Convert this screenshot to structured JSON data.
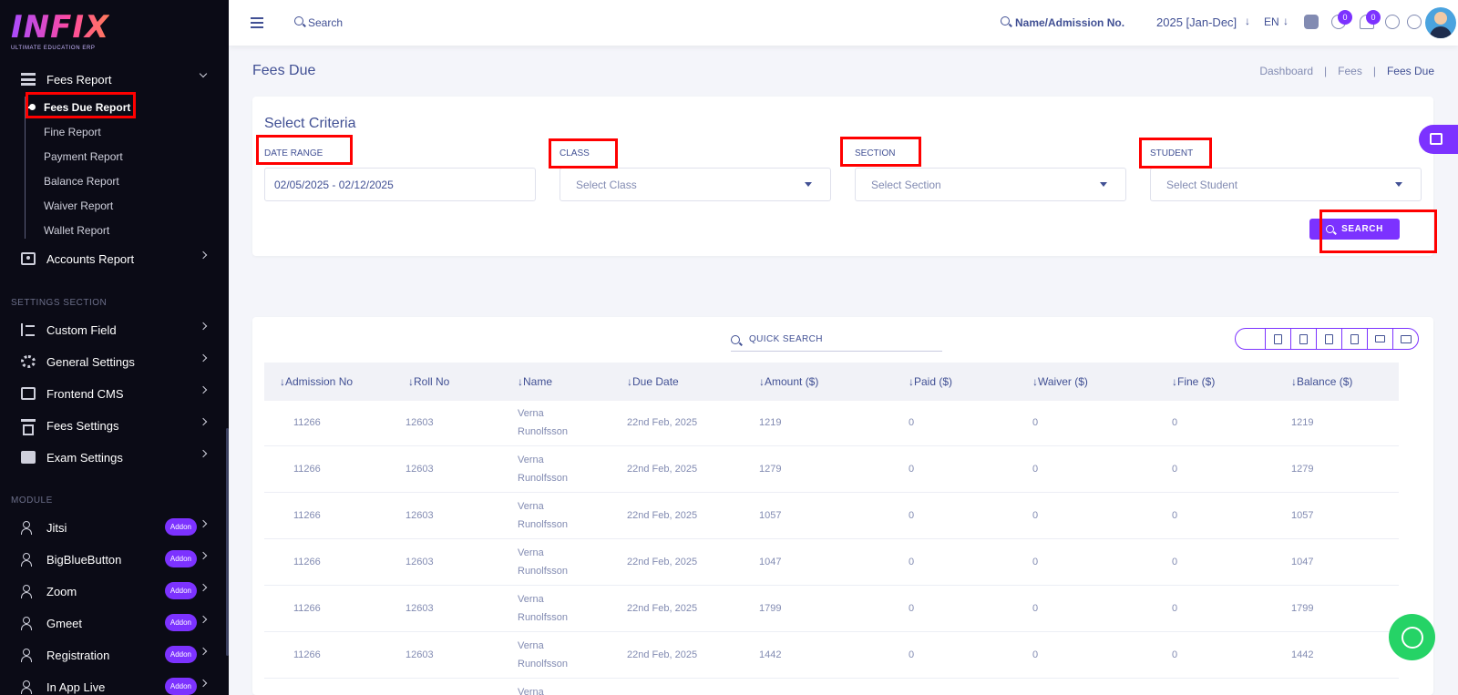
{
  "brand": {
    "name": "INFIX",
    "tagline": "ULTIMATE EDUCATION ERP"
  },
  "sidebar": {
    "fees_report": {
      "label": "Fees Report"
    },
    "fees_sub": [
      "Fees Due Report",
      "Fine Report",
      "Payment Report",
      "Balance Report",
      "Waiver Report",
      "Wallet Report"
    ],
    "accounts_report": "Accounts Report",
    "settings_section_title": "SETTINGS SECTION",
    "settings": [
      "Custom Field",
      "General Settings",
      "Frontend CMS",
      "Fees Settings",
      "Exam Settings"
    ],
    "module_title": "MODULE",
    "modules": [
      "Jitsi",
      "BigBlueButton",
      "Zoom",
      "Gmeet",
      "Registration",
      "In App Live"
    ],
    "addon_label": "Addon"
  },
  "topbar": {
    "search_label": "Search",
    "student_search_label": "Name/Admission No.",
    "session": "2025 [Jan-Dec]",
    "lang": "EN",
    "notification_count": "0",
    "message_count": "0"
  },
  "page": {
    "title": "Fees Due",
    "breadcrumb": [
      "Dashboard",
      "Fees",
      "Fees Due"
    ]
  },
  "criteria": {
    "title": "Select Criteria",
    "date_range_label": "DATE RANGE",
    "date_range_value": "02/05/2025 - 02/12/2025",
    "class_label": "CLASS",
    "class_placeholder": "Select Class",
    "section_label": "SECTION",
    "section_placeholder": "Select Section",
    "student_label": "STUDENT",
    "student_placeholder": "Select Student",
    "search_button": "SEARCH"
  },
  "table": {
    "quick_search": "QUICK SEARCH",
    "export_icons": [
      "copy-icon",
      "excel-icon",
      "csv-icon",
      "pdf-icon",
      "print-icon",
      "column-visibility-icon"
    ],
    "columns": [
      "Admission No",
      "Roll No",
      "Name",
      "Due Date",
      "Amount ($)",
      "Paid ($)",
      "Waiver ($)",
      "Fine ($)",
      "Balance ($)"
    ],
    "rows": [
      {
        "admission": "11266",
        "roll": "12603",
        "name1": "Verna",
        "name2": "Runolfsson",
        "due": "22nd Feb, 2025",
        "amount": "1219",
        "paid": "0",
        "waiver": "0",
        "fine": "0",
        "balance": "1219"
      },
      {
        "admission": "11266",
        "roll": "12603",
        "name1": "Verna",
        "name2": "Runolfsson",
        "due": "22nd Feb, 2025",
        "amount": "1279",
        "paid": "0",
        "waiver": "0",
        "fine": "0",
        "balance": "1279"
      },
      {
        "admission": "11266",
        "roll": "12603",
        "name1": "Verna",
        "name2": "Runolfsson",
        "due": "22nd Feb, 2025",
        "amount": "1057",
        "paid": "0",
        "waiver": "0",
        "fine": "0",
        "balance": "1057"
      },
      {
        "admission": "11266",
        "roll": "12603",
        "name1": "Verna",
        "name2": "Runolfsson",
        "due": "22nd Feb, 2025",
        "amount": "1047",
        "paid": "0",
        "waiver": "0",
        "fine": "0",
        "balance": "1047"
      },
      {
        "admission": "11266",
        "roll": "12603",
        "name1": "Verna",
        "name2": "Runolfsson",
        "due": "22nd Feb, 2025",
        "amount": "1799",
        "paid": "0",
        "waiver": "0",
        "fine": "0",
        "balance": "1799"
      },
      {
        "admission": "11266",
        "roll": "12603",
        "name1": "Verna",
        "name2": "Runolfsson",
        "due": "22nd Feb, 2025",
        "amount": "1442",
        "paid": "0",
        "waiver": "0",
        "fine": "0",
        "balance": "1442"
      },
      {
        "admission": "",
        "roll": "",
        "name1": "Verna",
        "name2": "",
        "due": "",
        "amount": "",
        "paid": "",
        "waiver": "",
        "fine": "",
        "balance": ""
      }
    ]
  },
  "colors": {
    "accent": "#7c32ff",
    "sidebar_bg": "#0b0b16",
    "text": "#415094",
    "muted": "#828bb2",
    "highlight": "#ff0000",
    "whatsapp": "#25d366"
  }
}
